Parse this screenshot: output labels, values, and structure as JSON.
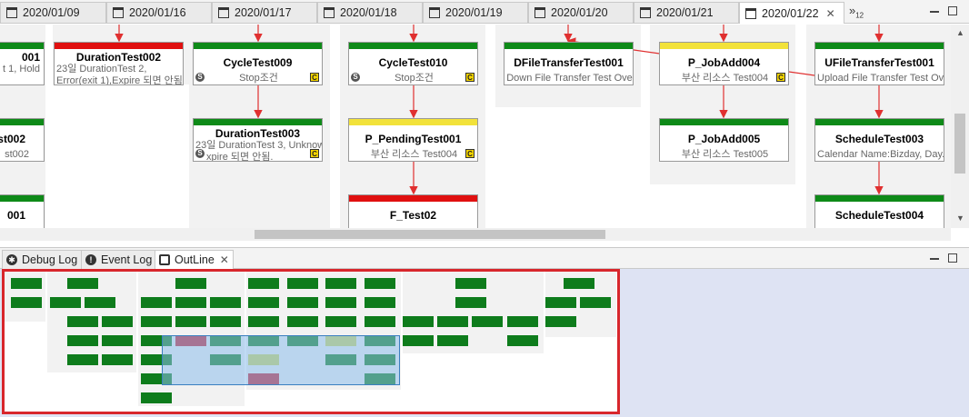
{
  "editor_tabs": [
    {
      "label": "2020/01/09",
      "active": false
    },
    {
      "label": "2020/01/16",
      "active": false
    },
    {
      "label": "2020/01/17",
      "active": false
    },
    {
      "label": "2020/01/18",
      "active": false
    },
    {
      "label": "2020/01/19",
      "active": false
    },
    {
      "label": "2020/01/20",
      "active": false
    },
    {
      "label": "2020/01/21",
      "active": false
    },
    {
      "label": "2020/01/22",
      "active": true
    }
  ],
  "overflow_count": "12",
  "nodes": [
    {
      "name": "001",
      "desc": "t 1, Hold",
      "status": "green"
    },
    {
      "name": "DurationTest002",
      "desc": "23일 DurationTest 2,",
      "desc2": "Error(exit 1),Expire 되면 안됨",
      "status": "red"
    },
    {
      "name": "CycleTest009",
      "desc": "Stop조건",
      "status": "green",
      "badge_s": "S",
      "badge_c": "C"
    },
    {
      "name": "CycleTest010",
      "desc": "Stop조건",
      "status": "green",
      "badge_s": "S",
      "badge_c": "C"
    },
    {
      "name": "DFileTransferTest001",
      "desc": "Down File Transfer Test Ove",
      "status": "green"
    },
    {
      "name": "P_JobAdd004",
      "desc": "부산 리소스 Test004",
      "status": "yellow",
      "badge_c": "C"
    },
    {
      "name": "UFileTransferTest001",
      "desc": "Upload File Transfer Test Ov",
      "status": "green"
    },
    {
      "name": "st002",
      "desc": "st002",
      "status": "green"
    },
    {
      "name": "DurationTest003",
      "desc": "23일 DurationTest 3, Unknow",
      "desc2": "xpire 되면 안됨.",
      "status": "green",
      "badge_s": "S",
      "badge_c": "C"
    },
    {
      "name": "P_PendingTest001",
      "desc": "부산 리소스 Test004",
      "status": "yellow",
      "badge_c": "C"
    },
    {
      "name": "P_JobAdd005",
      "desc": "부산 리소스 Test005",
      "status": "green"
    },
    {
      "name": "ScheduleTest003",
      "desc": "Calendar Name:Bizday, Day..",
      "status": "green"
    },
    {
      "name": "001",
      "desc": "",
      "status": "green"
    },
    {
      "name": "F_Test02",
      "desc": "",
      "status": "red"
    },
    {
      "name": "ScheduleTest004",
      "desc": "",
      "status": "green"
    }
  ],
  "view_tabs": [
    {
      "label": "Debug Log",
      "icon": "bug-icon",
      "active": false
    },
    {
      "label": "Event Log",
      "icon": "exclamation-icon",
      "active": false
    },
    {
      "label": "OutLine",
      "icon": "outline-icon",
      "active": true
    }
  ],
  "colors": {
    "ok": "#0e8a18",
    "error": "#e01010",
    "warning": "#f2e23a",
    "highlight": "#d8262c"
  }
}
